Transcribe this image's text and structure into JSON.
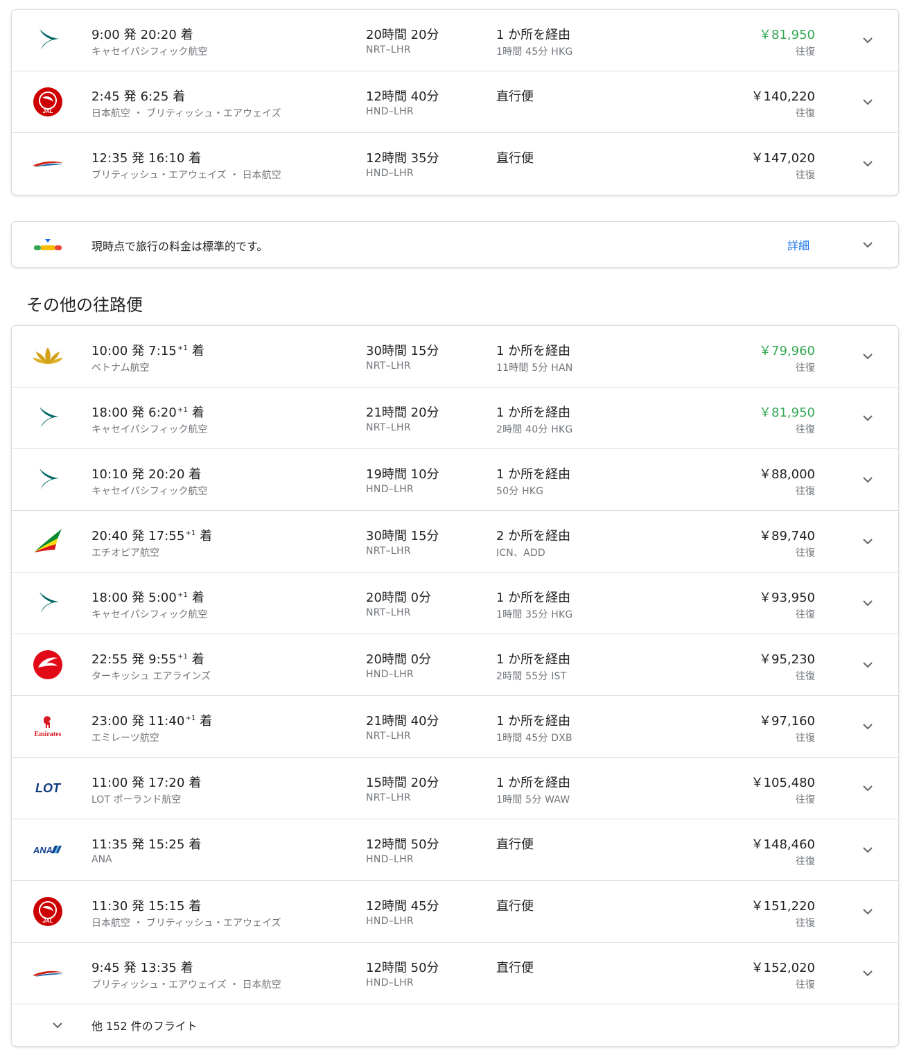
{
  "top_flights": [
    {
      "logo": "cathay-logo",
      "dep": "9:00",
      "dep_suffix": "発",
      "arr": "20:20",
      "arr_plus": "",
      "arr_suffix": "着",
      "airline": "キャセイパシフィック航空",
      "duration": "20時間 20分",
      "route": "NRT–LHR",
      "stops": "1 か所を経由",
      "stop_detail": "1時間 45分 HKG",
      "price": "￥81,950",
      "price_green": true,
      "price_type": "往復"
    },
    {
      "logo": "jal-logo",
      "dep": "2:45",
      "dep_suffix": "発",
      "arr": "6:25",
      "arr_plus": "",
      "arr_suffix": "着",
      "airline": "日本航空 ・ ブリティッシュ・エアウェイズ",
      "duration": "12時間 40分",
      "route": "HND–LHR",
      "stops": "直行便",
      "stop_detail": "",
      "price": "￥140,220",
      "price_green": false,
      "price_type": "往復"
    },
    {
      "logo": "ba-logo",
      "dep": "12:35",
      "dep_suffix": "発",
      "arr": "16:10",
      "arr_plus": "",
      "arr_suffix": "着",
      "airline": "ブリティッシュ・エアウェイズ ・ 日本航空",
      "duration": "12時間 35分",
      "route": "HND–LHR",
      "stops": "直行便",
      "stop_detail": "",
      "price": "￥147,020",
      "price_green": false,
      "price_type": "往復"
    }
  ],
  "insight": {
    "text": "現時点で旅行の料金は標準的です。",
    "link": "詳細"
  },
  "section_title": "その他の往路便",
  "other_flights": [
    {
      "logo": "vietnam-logo",
      "dep": "10:00",
      "dep_suffix": "発",
      "arr": "7:15",
      "arr_plus": "+1",
      "arr_suffix": "着",
      "airline": "ベトナム航空",
      "duration": "30時間 15分",
      "route": "NRT–LHR",
      "stops": "1 か所を経由",
      "stop_detail": "11時間 5分 HAN",
      "price": "￥79,960",
      "price_green": true,
      "price_type": "往復"
    },
    {
      "logo": "cathay-logo",
      "dep": "18:00",
      "dep_suffix": "発",
      "arr": "6:20",
      "arr_plus": "+1",
      "arr_suffix": "着",
      "airline": "キャセイパシフィック航空",
      "duration": "21時間 20分",
      "route": "NRT–LHR",
      "stops": "1 か所を経由",
      "stop_detail": "2時間 40分 HKG",
      "price": "￥81,950",
      "price_green": true,
      "price_type": "往復"
    },
    {
      "logo": "cathay-logo",
      "dep": "10:10",
      "dep_suffix": "発",
      "arr": "20:20",
      "arr_plus": "",
      "arr_suffix": "着",
      "airline": "キャセイパシフィック航空",
      "duration": "19時間 10分",
      "route": "HND–LHR",
      "stops": "1 か所を経由",
      "stop_detail": "50分 HKG",
      "price": "￥88,000",
      "price_green": false,
      "price_type": "往復"
    },
    {
      "logo": "ethiopian-logo",
      "dep": "20:40",
      "dep_suffix": "発",
      "arr": "17:55",
      "arr_plus": "+1",
      "arr_suffix": "着",
      "airline": "エチオピア航空",
      "duration": "30時間 15分",
      "route": "NRT–LHR",
      "stops": "2 か所を経由",
      "stop_detail": "ICN、ADD",
      "price": "￥89,740",
      "price_green": false,
      "price_type": "往復"
    },
    {
      "logo": "cathay-logo",
      "dep": "18:00",
      "dep_suffix": "発",
      "arr": "5:00",
      "arr_plus": "+1",
      "arr_suffix": "着",
      "airline": "キャセイパシフィック航空",
      "duration": "20時間 0分",
      "route": "NRT–LHR",
      "stops": "1 か所を経由",
      "stop_detail": "1時間 35分 HKG",
      "price": "￥93,950",
      "price_green": false,
      "price_type": "往復"
    },
    {
      "logo": "turkish-logo",
      "dep": "22:55",
      "dep_suffix": "発",
      "arr": "9:55",
      "arr_plus": "+1",
      "arr_suffix": "着",
      "airline": "ターキッシュ エアラインズ",
      "duration": "20時間 0分",
      "route": "HND–LHR",
      "stops": "1 か所を経由",
      "stop_detail": "2時間 55分 IST",
      "price": "￥95,230",
      "price_green": false,
      "price_type": "往復"
    },
    {
      "logo": "emirates-logo",
      "dep": "23:00",
      "dep_suffix": "発",
      "arr": "11:40",
      "arr_plus": "+1",
      "arr_suffix": "着",
      "airline": "エミレーツ航空",
      "duration": "21時間 40分",
      "route": "NRT–LHR",
      "stops": "1 か所を経由",
      "stop_detail": "1時間 45分 DXB",
      "price": "￥97,160",
      "price_green": false,
      "price_type": "往復"
    },
    {
      "logo": "lot-logo",
      "dep": "11:00",
      "dep_suffix": "発",
      "arr": "17:20",
      "arr_plus": "",
      "arr_suffix": "着",
      "airline": "LOT ポーランド航空",
      "duration": "15時間 20分",
      "route": "NRT–LHR",
      "stops": "1 か所を経由",
      "stop_detail": "1時間 5分 WAW",
      "price": "￥105,480",
      "price_green": false,
      "price_type": "往復"
    },
    {
      "logo": "ana-logo",
      "dep": "11:35",
      "dep_suffix": "発",
      "arr": "15:25",
      "arr_plus": "",
      "arr_suffix": "着",
      "airline": "ANA",
      "duration": "12時間 50分",
      "route": "HND–LHR",
      "stops": "直行便",
      "stop_detail": "",
      "price": "￥148,460",
      "price_green": false,
      "price_type": "往復"
    },
    {
      "logo": "jal-logo",
      "dep": "11:30",
      "dep_suffix": "発",
      "arr": "15:15",
      "arr_plus": "",
      "arr_suffix": "着",
      "airline": "日本航空 ・ ブリティッシュ・エアウェイズ",
      "duration": "12時間 45分",
      "route": "HND–LHR",
      "stops": "直行便",
      "stop_detail": "",
      "price": "￥151,220",
      "price_green": false,
      "price_type": "往復"
    },
    {
      "logo": "ba-logo",
      "dep": "9:45",
      "dep_suffix": "発",
      "arr": "13:35",
      "arr_plus": "",
      "arr_suffix": "着",
      "airline": "ブリティッシュ・エアウェイズ ・ 日本航空",
      "duration": "12時間 50分",
      "route": "HND–LHR",
      "stops": "直行便",
      "stop_detail": "",
      "price": "￥152,020",
      "price_green": false,
      "price_type": "往復"
    }
  ],
  "more_flights": "他 152 件のフライト",
  "logo_text": {
    "jal": "JAL",
    "emirates": "Emirates",
    "lot": "LOT",
    "ana": "ANA"
  },
  "colors": {
    "green_price": "#34a853",
    "link": "#1a73e8",
    "cathay": "#006564",
    "jal": "#cc0000",
    "turkish": "#e30a17",
    "emirates": "#d71921",
    "lot": "#11397e",
    "ana": "#13448f"
  }
}
